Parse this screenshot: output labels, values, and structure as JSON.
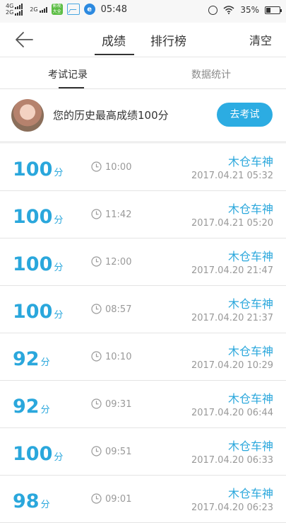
{
  "status_bar": {
    "network_1": "4G",
    "network_2": "2G",
    "network_3": "2G",
    "app_icon_text": "影视大全",
    "time": "05:48",
    "battery": "35%",
    "battery_level": 0.35
  },
  "header": {
    "tabs": [
      {
        "label": "成绩"
      },
      {
        "label": "排行榜"
      }
    ],
    "clear_label": "清空"
  },
  "subtabs": [
    {
      "label": "考试记录"
    },
    {
      "label": "数据统计"
    }
  ],
  "best": {
    "text": "您的历史最高成绩100分",
    "button": "去考试"
  },
  "records": [
    {
      "score": "100",
      "unit": "分",
      "duration": "10:00",
      "user": "木仓车神",
      "date": "2017.04.21  05:32"
    },
    {
      "score": "100",
      "unit": "分",
      "duration": "11:42",
      "user": "木仓车神",
      "date": "2017.04.21  05:20"
    },
    {
      "score": "100",
      "unit": "分",
      "duration": "12:00",
      "user": "木仓车神",
      "date": "2017.04.20  21:47"
    },
    {
      "score": "100",
      "unit": "分",
      "duration": "08:57",
      "user": "木仓车神",
      "date": "2017.04.20  21:37"
    },
    {
      "score": "92",
      "unit": "分",
      "duration": "10:10",
      "user": "木仓车神",
      "date": "2017.04.20  10:29"
    },
    {
      "score": "92",
      "unit": "分",
      "duration": "09:31",
      "user": "木仓车神",
      "date": "2017.04.20  06:44"
    },
    {
      "score": "100",
      "unit": "分",
      "duration": "09:51",
      "user": "木仓车神",
      "date": "2017.04.20  06:33"
    },
    {
      "score": "98",
      "unit": "分",
      "duration": "09:01",
      "user": "木仓车神",
      "date": "2017.04.20  06:23"
    }
  ],
  "colors": {
    "accent": "#2aa7dc",
    "button": "#2cace2"
  }
}
